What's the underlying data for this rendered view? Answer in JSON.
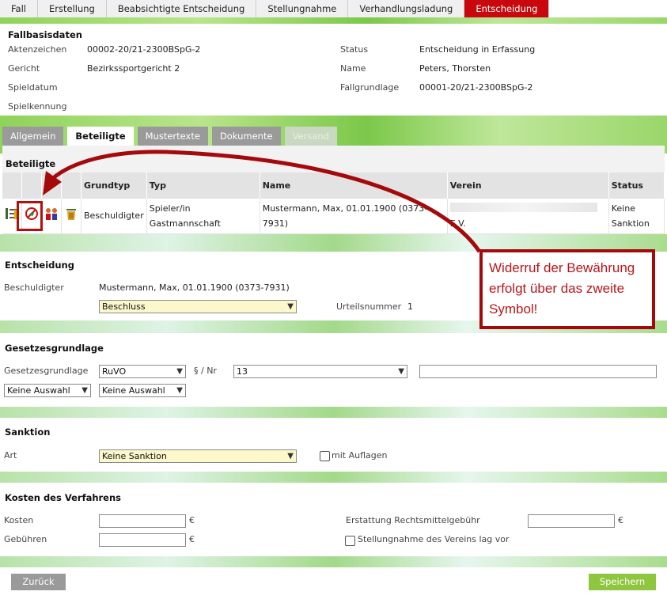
{
  "top_tabs": [
    {
      "label": "Fall",
      "active": false
    },
    {
      "label": "Erstellung",
      "active": false
    },
    {
      "label": "Beabsichtigte Entscheidung",
      "active": false
    },
    {
      "label": "Stellungnahme",
      "active": false
    },
    {
      "label": "Verhandlungsladung",
      "active": false
    },
    {
      "label": "Entscheidung",
      "active": true
    }
  ],
  "fallbasis": {
    "title": "Fallbasisdaten",
    "aktenzeichen_label": "Aktenzeichen",
    "aktenzeichen_value": "00002-20/21-2300BSpG-2",
    "gericht_label": "Gericht",
    "gericht_value": "Bezirkssportgericht 2",
    "spieldatum_label": "Spieldatum",
    "spielkennung_label": "Spielkennung",
    "status_label": "Status",
    "status_value": "Entscheidung in Erfassung",
    "name_label": "Name",
    "name_value": "Peters, Thorsten",
    "fallgrundlage_label": "Fallgrundlage",
    "fallgrundlage_value": "00001-20/21-2300BSpG-2"
  },
  "sub_tabs": [
    {
      "label": "Allgemein",
      "state": "normal"
    },
    {
      "label": "Beteiligte",
      "state": "active"
    },
    {
      "label": "Mustertexte",
      "state": "normal"
    },
    {
      "label": "Dokumente",
      "state": "normal"
    },
    {
      "label": "Versand",
      "state": "disabled"
    }
  ],
  "beteiligte": {
    "title": "Beteiligte",
    "columns": [
      "Grundtyp",
      "Typ",
      "Name",
      "Verein",
      "Status"
    ],
    "rows": [
      {
        "grundtyp": "Beschuldigter",
        "typ_line1": "Spieler/in",
        "typ_line2": "Gastmannschaft",
        "name_line1": "Mustermann, Max, 01.01.1900 (0373-",
        "name_line2": "7931)",
        "verein_suffix": "E.V.",
        "status_line1": "Keine",
        "status_line2": "Sanktion"
      }
    ],
    "row_icons": [
      "list-edit-icon",
      "revoke-probation-icon",
      "persons-icon",
      "trash-icon"
    ]
  },
  "entscheidung": {
    "title": "Entscheidung",
    "beschuldigter_label": "Beschuldigter",
    "beschuldigter_value": "Mustermann, Max, 01.01.1900 (0373-7931)",
    "art_select": "Beschluss",
    "urteilsnummer_label": "Urteilsnummer",
    "urteilsnummer_value": "1"
  },
  "gesetzesgrundlage": {
    "title": "Gesetzesgrundlage",
    "label": "Gesetzesgrundlage",
    "regel_select": "RuVO",
    "paragraph_label": "§ / Nr",
    "paragraph_select": "13",
    "text_value": "",
    "select_a": "Keine Auswahl",
    "select_b": "Keine Auswahl"
  },
  "sanktion": {
    "title": "Sanktion",
    "art_label": "Art",
    "art_select": "Keine Sanktion",
    "auflagen_label": "mit Auflagen",
    "auflagen_checked": false
  },
  "kosten": {
    "title": "Kosten des Verfahrens",
    "kosten_label": "Kosten",
    "gebuehren_label": "Gebühren",
    "currency": "€",
    "erstattung_label": "Erstattung Rechtsmittelgebühr",
    "stellungnahme_label": "Stellungnahme des Vereins lag vor",
    "stellungnahme_checked": false
  },
  "buttons": {
    "back": "Zurück",
    "save": "Speichern"
  },
  "annotation": {
    "callout_text": "Widerruf der Bewährung erfolgt über das zweite Symbol!"
  },
  "colors": {
    "active_tab": "#c8080c",
    "annotation_red": "#a40a0c",
    "save_button": "#8ec63f",
    "back_button": "#9a9a9a",
    "select_highlight": "#fdf7cc"
  }
}
